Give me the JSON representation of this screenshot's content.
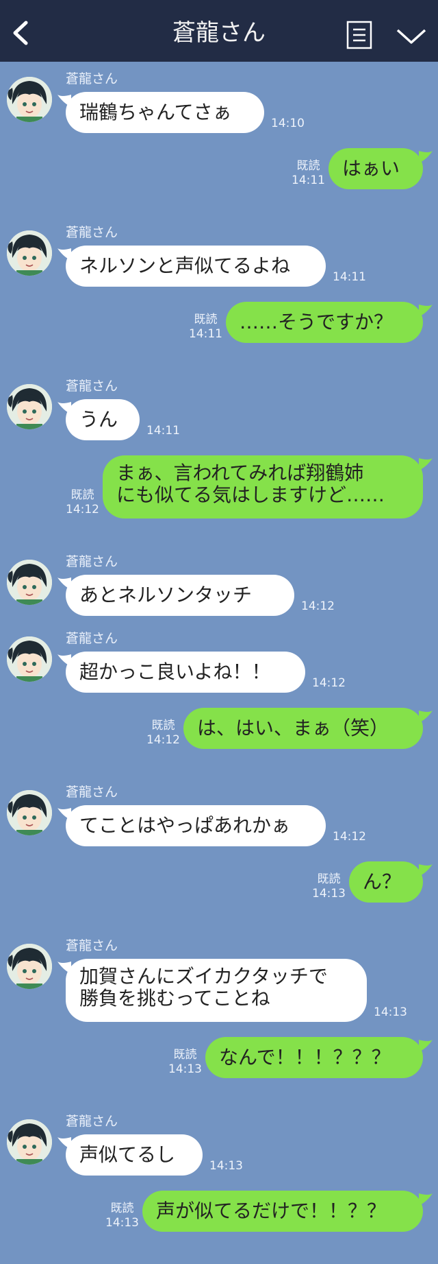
{
  "header": {
    "title": "蒼龍さん",
    "icons": [
      "back-icon",
      "menu-icon",
      "chevron-down-icon"
    ]
  },
  "read_label": "既読",
  "colors": {
    "header_bg": "#222c45",
    "chat_bg": "#7394c2",
    "incoming": "#ffffff",
    "outgoing": "#85e14a"
  },
  "messages": [
    {
      "dir": "in",
      "sender": "蒼龍さん",
      "text": "瑞鶴ちゃんてさぁ",
      "time": "14:10"
    },
    {
      "dir": "out",
      "text": "はぁい",
      "time": "14:11"
    },
    {
      "dir": "in",
      "sender": "蒼龍さん",
      "text": "ネルソンと声似てるよね",
      "time": "14:11"
    },
    {
      "dir": "out",
      "text": "……そうですか？",
      "time": "14:11"
    },
    {
      "dir": "in",
      "sender": "蒼龍さん",
      "text": "うん",
      "time": "14:11"
    },
    {
      "dir": "out",
      "lines": [
        "まぁ、言われてみれば翔鶴姉",
        "にも似てる気はしますけど……"
      ],
      "time": "14:12"
    },
    {
      "dir": "in",
      "sender": "蒼龍さん",
      "text": "あとネルソンタッチ",
      "time": "14:12"
    },
    {
      "dir": "in",
      "sender": "蒼龍さん",
      "text": "超かっこ良いよね！！",
      "time": "14:12"
    },
    {
      "dir": "out",
      "text": "は、はい、まぁ（笑）",
      "time": "14:12"
    },
    {
      "dir": "in",
      "sender": "蒼龍さん",
      "text": "てことはやっぱあれかぁ",
      "time": "14:12"
    },
    {
      "dir": "out",
      "text": "ん？",
      "time": "14:13"
    },
    {
      "dir": "in",
      "sender": "蒼龍さん",
      "lines": [
        "加賀さんにズイカクタッチで",
        "勝負を挑むってことね"
      ],
      "time": "14:13"
    },
    {
      "dir": "out",
      "text": "なんで！！！？？？",
      "time": "14:13"
    },
    {
      "dir": "in",
      "sender": "蒼龍さん",
      "text": "声似てるし",
      "time": "14:13"
    },
    {
      "dir": "out",
      "text": "声が似てるだけで！！？？",
      "time": "14:13"
    }
  ]
}
